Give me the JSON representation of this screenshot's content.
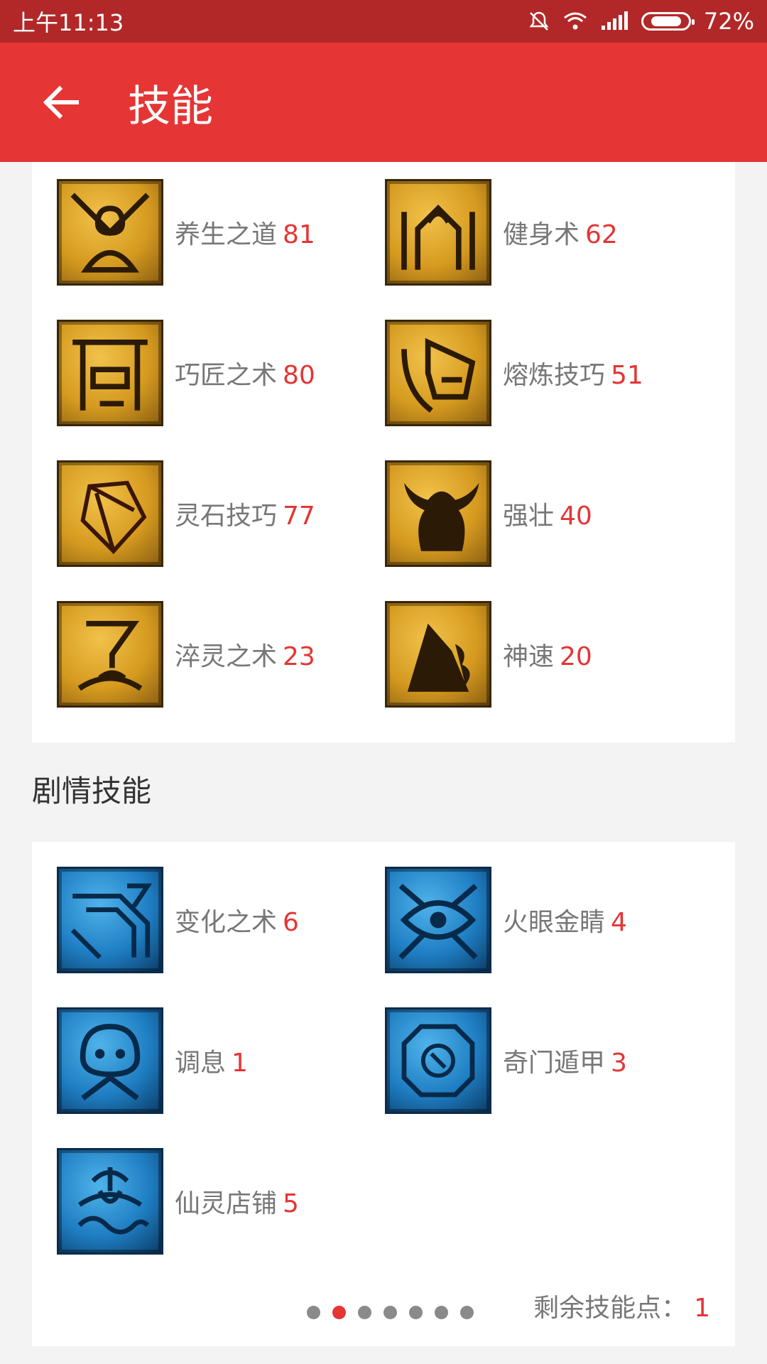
{
  "status_bar": {
    "time": "上午11:13",
    "battery": "72%",
    "battery_level": 0.72
  },
  "app_bar": {
    "title": "技能"
  },
  "normal_skills": [
    {
      "name": "养生之道",
      "level": "81",
      "icon": "meditation-icon"
    },
    {
      "name": "健身术",
      "level": "62",
      "icon": "fitness-icon"
    },
    {
      "name": "巧匠之术",
      "level": "80",
      "icon": "anvil-icon"
    },
    {
      "name": "熔炼技巧",
      "level": "51",
      "icon": "smelting-icon"
    },
    {
      "name": "灵石技巧",
      "level": "77",
      "icon": "crystal-icon"
    },
    {
      "name": "强壮",
      "level": "40",
      "icon": "strength-icon"
    },
    {
      "name": "淬灵之术",
      "level": "23",
      "icon": "quench-icon"
    },
    {
      "name": "神速",
      "level": "20",
      "icon": "speed-icon"
    }
  ],
  "story_section": {
    "title": "剧情技能"
  },
  "story_skills": [
    {
      "name": "变化之术",
      "level": "6",
      "icon": "transform-icon"
    },
    {
      "name": "火眼金睛",
      "level": "4",
      "icon": "eye-icon"
    },
    {
      "name": "调息",
      "level": "1",
      "icon": "breath-icon"
    },
    {
      "name": "奇门遁甲",
      "level": "3",
      "icon": "compass-icon"
    },
    {
      "name": "仙灵店铺",
      "level": "5",
      "icon": "shop-icon"
    }
  ],
  "footer": {
    "points_label": "剩余技能点：",
    "points_value": "1",
    "page_count": 7,
    "active_page": 2
  },
  "colors": {
    "primary": "#e53535",
    "status_bar": "#b22828",
    "text_secondary": "#777777"
  }
}
